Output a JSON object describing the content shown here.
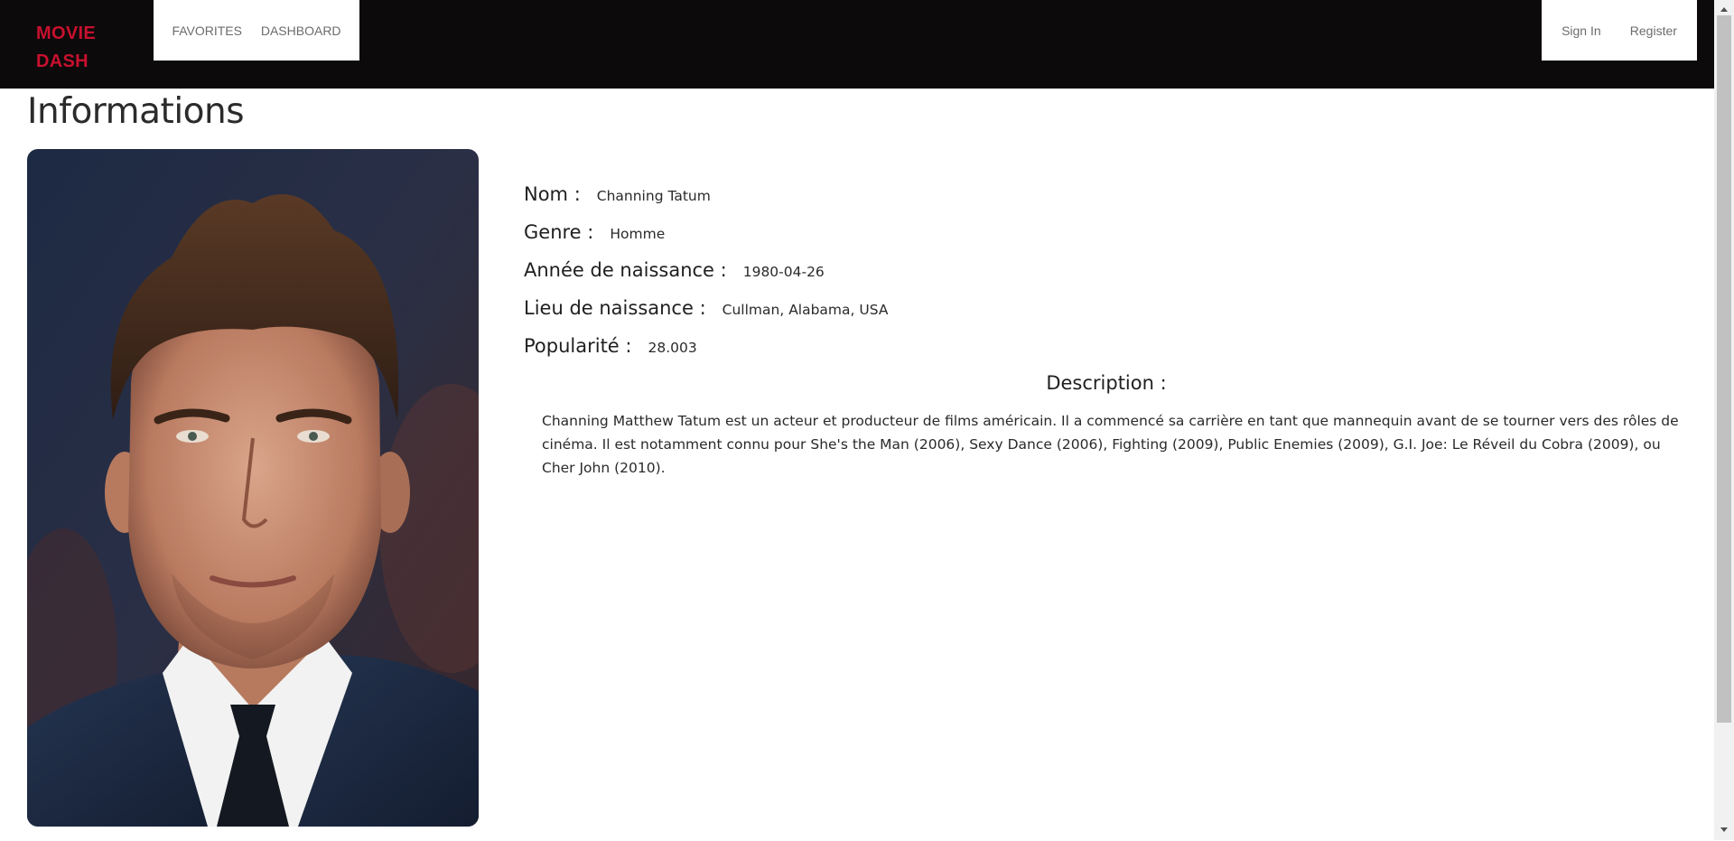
{
  "navbar": {
    "brand": "MOVIE DASH",
    "left_links": [
      "FAVORITES",
      "DASHBOARD"
    ],
    "right_links": [
      "Sign In",
      "Register"
    ]
  },
  "page": {
    "title": "Informations"
  },
  "person": {
    "name_label": "Nom :",
    "name": "Channing Tatum",
    "gender_label": "Genre :",
    "gender": "Homme",
    "birth_label": "Année de naissance :",
    "birth": "1980-04-26",
    "place_label": "Lieu de naissance :",
    "place": "Cullman, Alabama, USA",
    "popularity_label": "Popularité :",
    "popularity": "28.003",
    "description_label": "Description :",
    "description": "Channing Matthew Tatum est un acteur et producteur de films américain. Il a commencé sa carrière en tant que mannequin avant de se tourner vers des rôles de cinéma. Il est notamment connu pour She's the Man (2006), Sexy Dance (2006), Fighting (2009), Public Enemies (2009), G.I. Joe: Le Réveil du Cobra (2009), ou Cher John (2010)."
  },
  "colors": {
    "navbar_bg": "#0c0a0b",
    "brand": "#c8102e"
  },
  "icons": {
    "scroll_up": "triangle-up-icon",
    "scroll_down": "triangle-down-icon"
  }
}
